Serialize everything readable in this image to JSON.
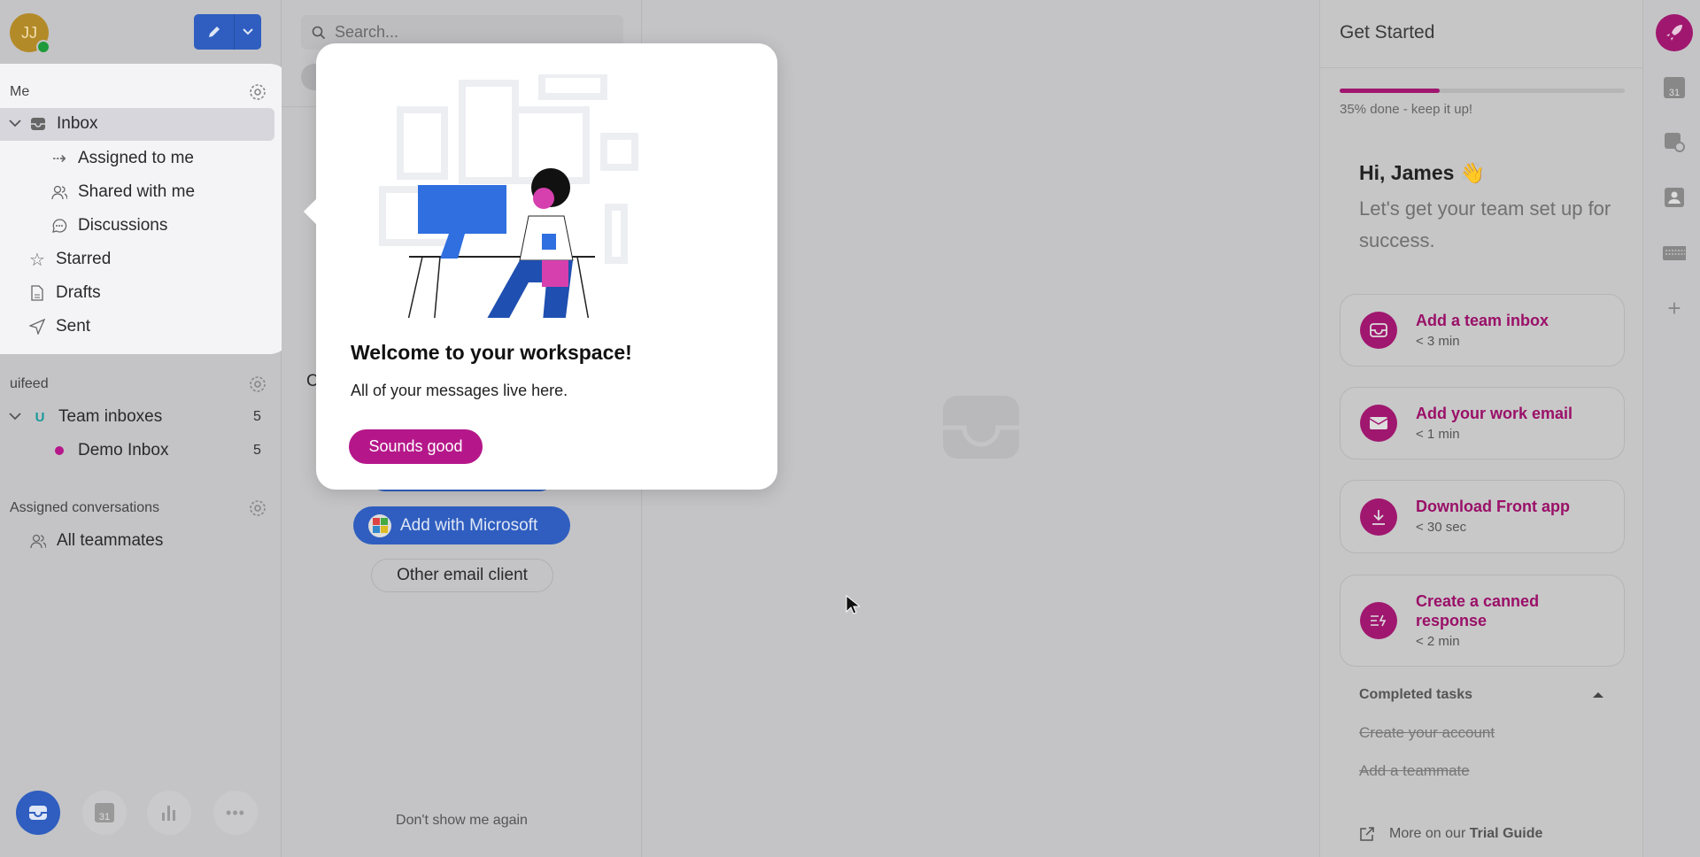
{
  "sidebar": {
    "avatar_initials": "JJ",
    "me_label": "Me",
    "items": [
      {
        "label": "Inbox",
        "icon": "inbox-icon"
      },
      {
        "label": "Assigned to me",
        "icon": "assign-icon"
      },
      {
        "label": "Shared with me",
        "icon": "users-icon"
      },
      {
        "label": "Discussions",
        "icon": "chat-icon"
      },
      {
        "label": "Starred",
        "icon": "star-icon"
      },
      {
        "label": "Drafts",
        "icon": "document-icon"
      },
      {
        "label": "Sent",
        "icon": "send-icon"
      }
    ],
    "workspace_label": "uifeed",
    "team_inboxes": {
      "label": "Team inboxes",
      "badge": "U",
      "count": "5"
    },
    "demo_inbox": {
      "label": "Demo Inbox",
      "count": "5"
    },
    "assigned_label": "Assigned conversations",
    "all_teammates": "All teammates",
    "bottom_icons": [
      "inbox-icon",
      "calendar-icon",
      "analytics-icon",
      "more-icon"
    ],
    "calendar_day": "31"
  },
  "search": {
    "placeholder": "Search..."
  },
  "middle": {
    "partial_letter": "C",
    "add_microsoft": "Add with Microsoft",
    "other_client": "Other email client",
    "dont_show": "Don't show me again"
  },
  "popup": {
    "title": "Welcome to your workspace!",
    "body": "All of your messages live here.",
    "button": "Sounds good"
  },
  "get_started": {
    "title": "Get Started",
    "progress_percent": 35,
    "progress_text": "35% done - keep it up!",
    "greeting": "Hi, James 👋",
    "subtitle": "Let's get your team set up for success.",
    "tasks": [
      {
        "title": "Add a team inbox",
        "time": "< 3 min",
        "icon": "inbox-icon"
      },
      {
        "title": "Add your work email",
        "time": "< 1 min",
        "icon": "mail-icon"
      },
      {
        "title": "Download Front app",
        "time": "< 30 sec",
        "icon": "download-icon"
      },
      {
        "title": "Create a canned response",
        "time": "< 2 min",
        "icon": "canned-response-icon"
      }
    ],
    "completed_label": "Completed tasks",
    "completed": [
      "Create your account",
      "Add a teammate"
    ],
    "more_prefix": "More on our ",
    "more_link": "Trial Guide"
  },
  "rail_icons": [
    "rocket-icon",
    "calendar-icon",
    "scheduled-icon",
    "contact-icon",
    "keyboard-icon",
    "plus-icon"
  ],
  "colors": {
    "accent": "#b5178a",
    "blue": "#2f5fc4"
  }
}
